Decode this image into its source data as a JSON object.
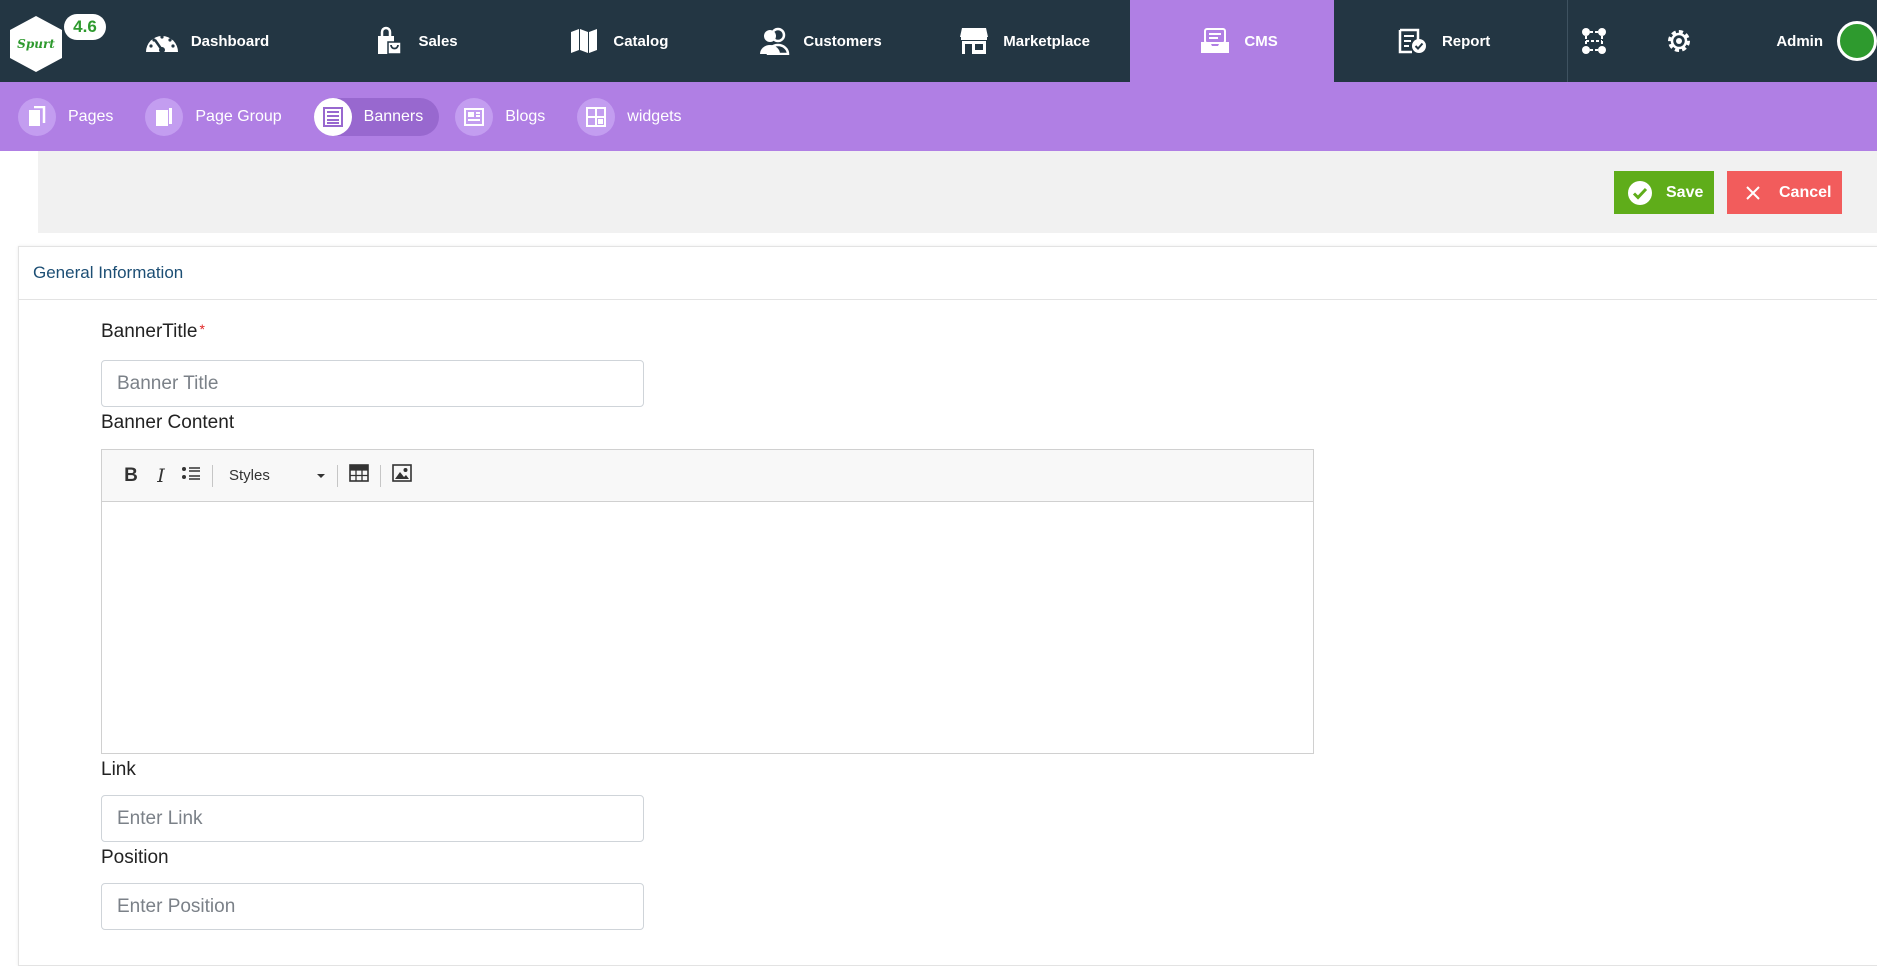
{
  "app": {
    "logo_text": "Spurt",
    "version": "4.6"
  },
  "nav": {
    "dashboard": "Dashboard",
    "sales": "Sales",
    "catalog": "Catalog",
    "customers": "Customers",
    "marketplace": "Marketplace",
    "cms": "CMS",
    "report": "Report",
    "user": "Admin"
  },
  "subnav": {
    "pages": "Pages",
    "page_group": "Page Group",
    "banners": "Banners",
    "blogs": "Blogs",
    "widgets": "widgets"
  },
  "actions": {
    "save": "Save",
    "cancel": "Cancel"
  },
  "form": {
    "section_title": "General Information",
    "banner_title_label": "BannerTitle",
    "banner_title_placeholder": "Banner Title",
    "banner_content_label": "Banner Content",
    "styles_label": "Styles",
    "link_label": "Link",
    "link_placeholder": "Enter Link",
    "position_label": "Position",
    "position_placeholder": "Enter Position",
    "required_mark": "*"
  },
  "colors": {
    "topbar": "#233643",
    "accent": "#b07fe4",
    "save": "#5fad1a",
    "cancel": "#f25c5c"
  }
}
